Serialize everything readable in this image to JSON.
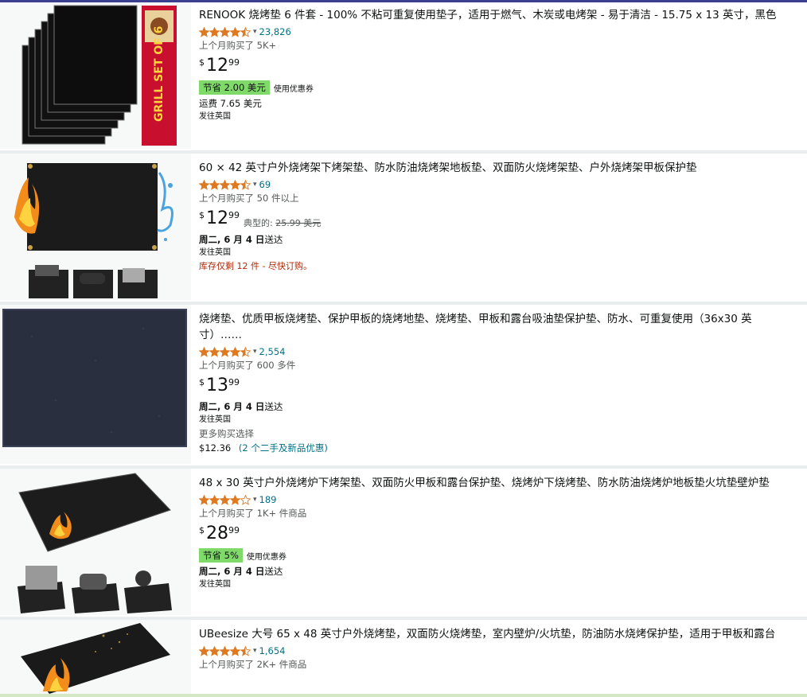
{
  "products": [
    {
      "title": "RENOOK 烧烤垫 6 件套 - 100% 不粘可重复使用垫子，适用于燃气、木炭或电烤架 - 易于清洁 - 15.75 x 13 英寸，黑色",
      "rating": 4.5,
      "review_count": "23,826",
      "bought": "上个月购买了 5K+",
      "price_currency": "$",
      "price_whole": "12",
      "price_fraction": "99",
      "coupon_badge": "节省 2.00 美元",
      "coupon_note": "使用优惠券",
      "shipping_fee": "运费 7.65 美元",
      "ships_to": "发往英国"
    },
    {
      "title": "60 × 42 英寸户外烧烤架下烤架垫、防水防油烧烤架地板垫、双面防火烧烤架垫、户外烧烤架甲板保护垫",
      "rating": 4.5,
      "review_count": "69",
      "bought": "上个月购买了 50 件以上",
      "price_currency": "$",
      "price_whole": "12",
      "price_fraction": "99",
      "typical_label": "典型的:",
      "typical_price": "25.99 美元",
      "delivery_date": "周二, 6 月 4 日",
      "delivery_suffix": "送达",
      "ships_to": "发往英国",
      "stock": "库存仅剩 12 件 - 尽快订购。"
    },
    {
      "title": "烧烤垫、优质甲板烧烤垫、保护甲板的烧烤地垫、烧烤垫、甲板和露台吸油垫保护垫、防水、可重复使用（36x30 英寸）……",
      "rating": 4.5,
      "review_count": "2,554",
      "bought": "上个月购买了 600 多件",
      "price_currency": "$",
      "price_whole": "13",
      "price_fraction": "99",
      "delivery_date": "周二, 6 月 4 日",
      "delivery_suffix": "送达",
      "ships_to": "发往英国",
      "more_options": "更多购买选择",
      "used_price": "$12.36",
      "used_offers": "(2 个二手及新品优惠)"
    },
    {
      "title": "48 x 30 英寸户外烧烤炉下烤架垫、双面防火甲板和露台保护垫、烧烤炉下烧烤垫、防水防油烧烤炉地板垫火坑垫壁炉垫",
      "rating": 4.0,
      "review_count": "189",
      "bought": "上个月购买了 1K+ 件商品",
      "price_currency": "$",
      "price_whole": "28",
      "price_fraction": "99",
      "coupon_badge": "节省 5%",
      "coupon_note": "使用优惠券",
      "delivery_date": "周二, 6 月 4 日",
      "delivery_suffix": "送达",
      "ships_to": "发往英国"
    },
    {
      "title": "UBeesize 大号 65 x 48 英寸户外烧烤垫，双面防火烧烤垫，室内壁炉/火坑垫，防油防水烧烤保护垫，适用于甲板和露台",
      "rating": 4.5,
      "review_count": "1,654",
      "bought": "上个月购买了 2K+ 件商品"
    }
  ],
  "colors": {
    "star": "#de7921",
    "link": "#007185",
    "coupon_badge": "#7fda69",
    "stock_warning": "#b12704",
    "separator": "#eaeded"
  },
  "icons": [
    "star-icon",
    "chevron-down-icon"
  ]
}
